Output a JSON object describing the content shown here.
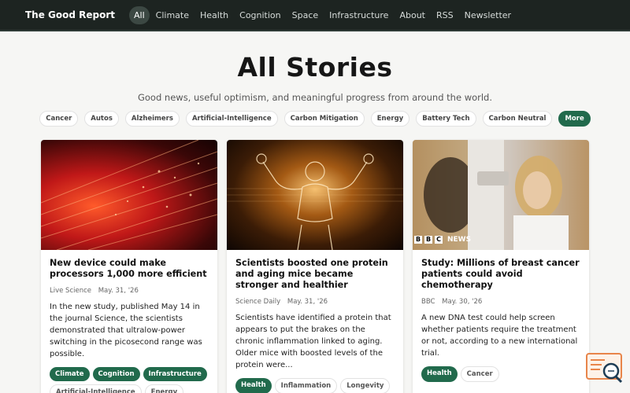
{
  "header": {
    "brand": "The Good Report",
    "nav": [
      "All",
      "Climate",
      "Health",
      "Cognition",
      "Space",
      "Infrastructure",
      "About",
      "RSS",
      "Newsletter"
    ]
  },
  "hero": {
    "title": "All Stories",
    "subtitle": "Good news, useful optimism, and meaningful progress from around the world."
  },
  "tags": [
    "Cancer",
    "Autos",
    "Alzheimers",
    "Artificial-Intelligence",
    "Carbon Mitigation",
    "Energy",
    "Battery Tech",
    "Carbon Neutral",
    "More"
  ],
  "cards": [
    {
      "title": "New device could make processors 1,000 more efficient",
      "source": "Live Science",
      "date": "May. 31, '26",
      "desc": "In the new study, published May 14 in the journal Science, the scientists demonstrated that ultralow-power switching in the picosecond range was possible.",
      "chips": [
        "Climate",
        "Cognition",
        "Infrastructure",
        "Artificial-Intelligence",
        "Energy"
      ]
    },
    {
      "title": "Scientists boosted one protein and aging mice became stronger and healthier",
      "source": "Science Daily",
      "date": "May. 31, '26",
      "desc": "Scientists have identified a protein that appears to put the brakes on the chronic inflammation linked to aging. Older mice with boosted levels of the protein were...",
      "chips": [
        "Health",
        "Inflammation",
        "Longevity"
      ]
    },
    {
      "title": "Study: Millions of breast cancer patients could avoid chemotherapy",
      "source": "BBC",
      "date": "May. 30, '26",
      "desc": "A new DNA test could help screen whether patients require the treatment or not, according to a new international trial.",
      "chips": [
        "Health",
        "Cancer"
      ],
      "image_logo": "BBC NEWS"
    }
  ],
  "colors": {
    "accent": "#216a4c",
    "topbar": "#1d2421"
  }
}
